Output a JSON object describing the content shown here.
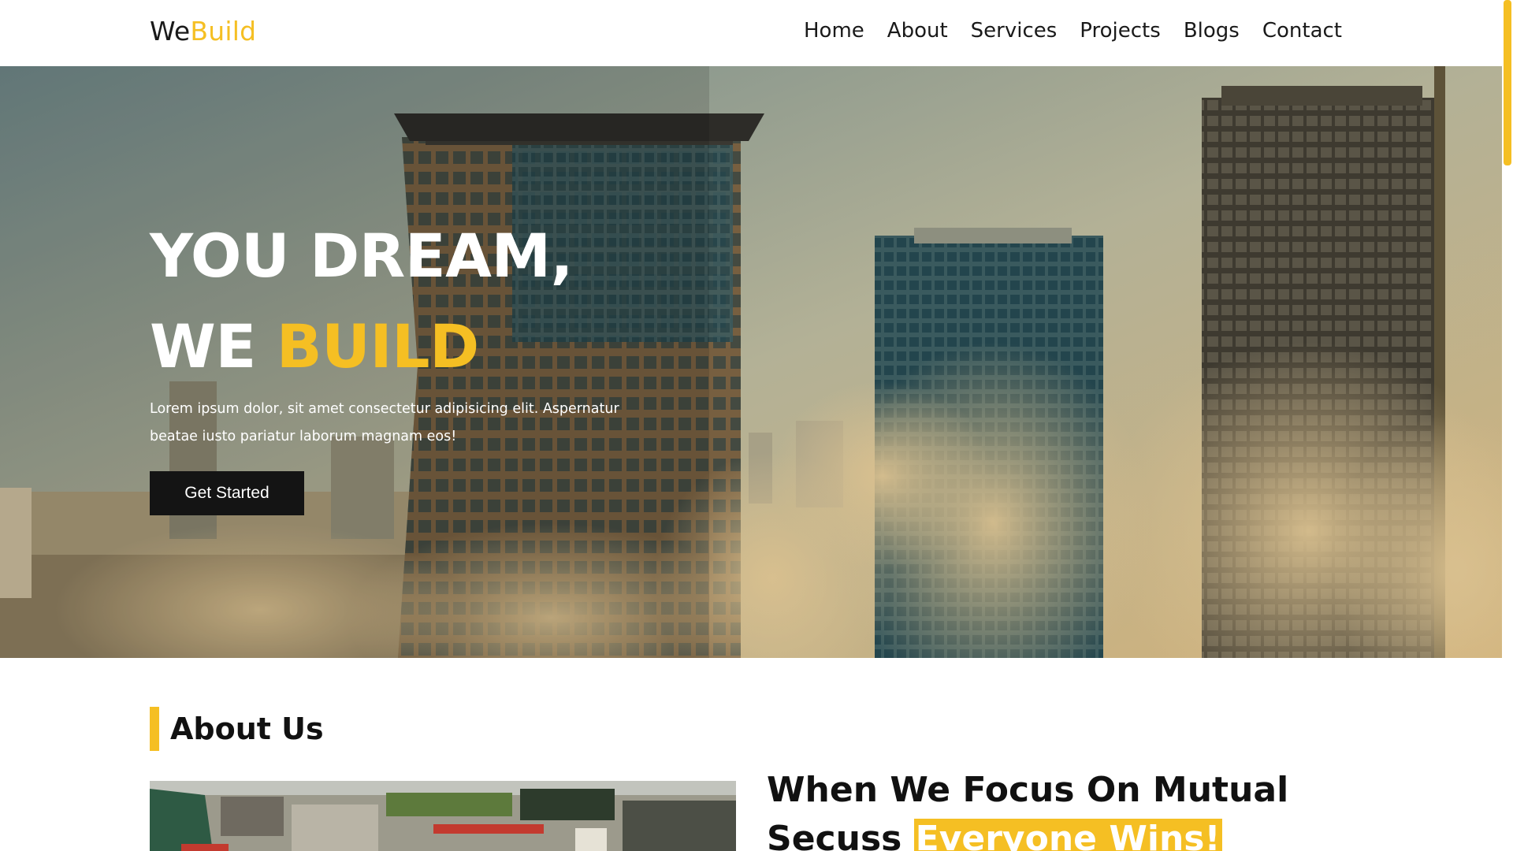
{
  "brand": {
    "logo_part1": "We",
    "logo_part2": "Build",
    "accent_color": "#f5bf23",
    "dark_color": "#141414"
  },
  "nav": {
    "items": [
      "Home",
      "About",
      "Services",
      "Projects",
      "Blogs",
      "Contact"
    ]
  },
  "hero": {
    "line1": "YOU DREAM,",
    "line2_part1": "WE",
    "line2_part2": "BUILD",
    "text": "Lorem ipsum dolor, sit amet consectetur adipisicing elit. Aspernatur beatae iusto pariatur laborum magnam eos!",
    "cta_label": "Get Started",
    "image_icon": "skyscrapers-in-clouds-photo"
  },
  "about": {
    "heading": "About Us",
    "headline_part1": "When We Focus On Mutual Secuss",
    "headline_highlight": "Everyone Wins!",
    "image_icon": "construction-site-photo"
  }
}
